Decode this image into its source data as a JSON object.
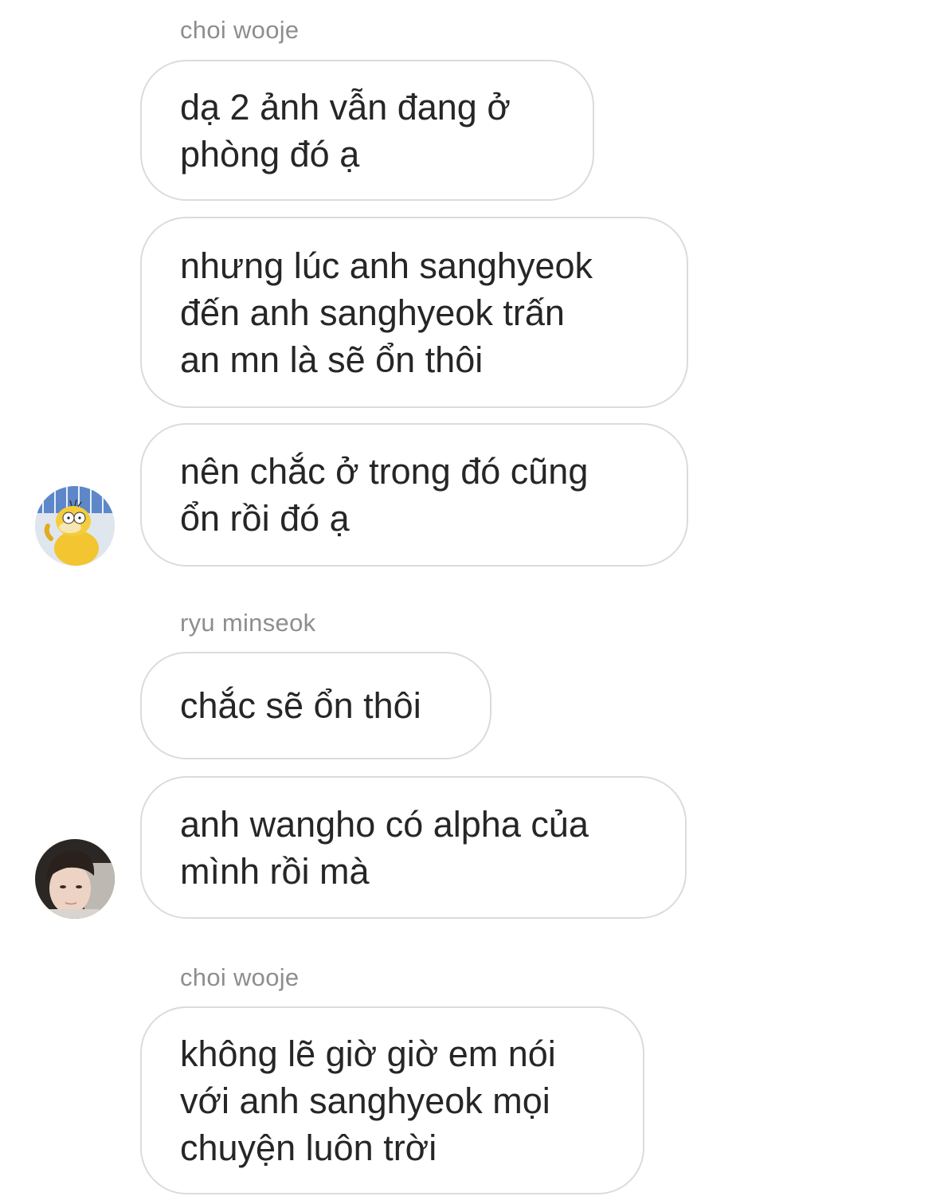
{
  "conversation": {
    "groups": [
      {
        "sender": "choi wooje",
        "messages": [
          "dạ 2 ảnh vẫn đang ở\nphòng đó ạ",
          "nhưng lúc anh sanghyeok\nđến anh sanghyeok trấn\nan mn là sẽ ổn thôi",
          "nên chắc ở trong đó cũng\nổn rồi đó ạ"
        ],
        "avatar": "psyduck-avatar"
      },
      {
        "sender": "ryu minseok",
        "messages": [
          "chắc sẽ ổn thôi",
          "anh wangho có alpha của\nmình rồi mà"
        ],
        "avatar": "person-avatar"
      },
      {
        "sender": "choi wooje",
        "messages": [
          "không lẽ giờ giờ em nói\nvới anh sanghyeok mọi\nchuyện luôn trời"
        ]
      }
    ]
  },
  "colors": {
    "bubble_border": "#dbdbdb",
    "sender_text": "#8e8e8e",
    "message_text": "#262626"
  }
}
